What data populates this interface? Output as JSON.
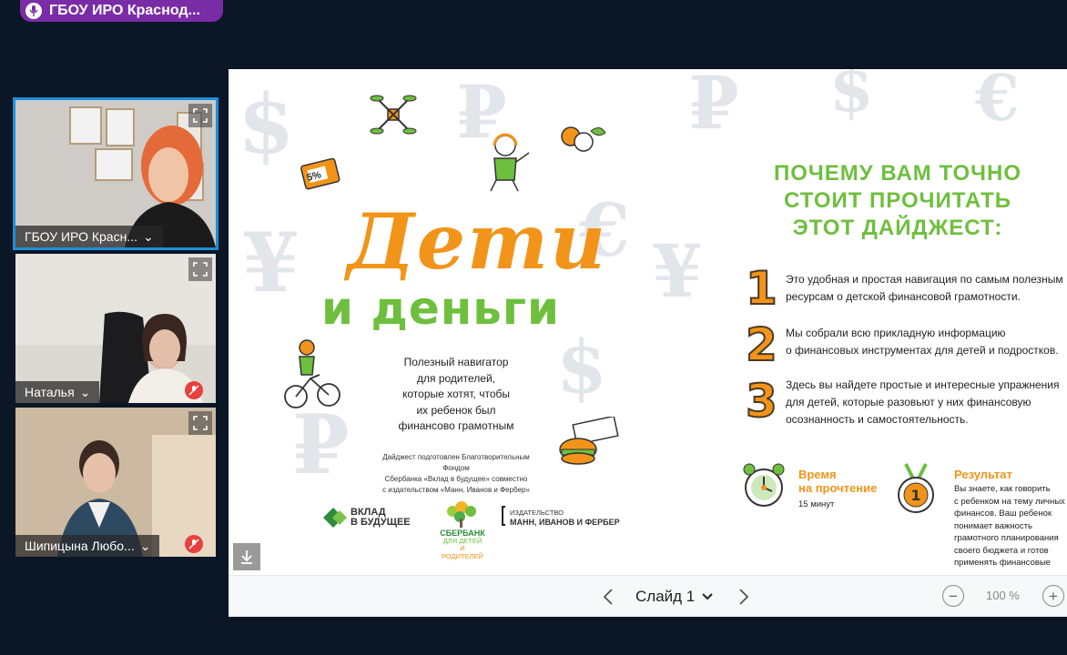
{
  "speaker": {
    "name": "ГБОУ ИРО Краснод..."
  },
  "participants": [
    {
      "name": "ГБОУ ИРО Красн...",
      "chevron": "⌄"
    },
    {
      "name": "Наталья",
      "chevron": "⌄"
    },
    {
      "name": "Шипицына Любо...",
      "chevron": "⌄"
    }
  ],
  "slide": {
    "title_line1": "Дети",
    "title_line2": "и деньги",
    "subtitle": [
      "Полезный навигатор",
      "для родителей,",
      "которые хотят, чтобы",
      "их ребенок был",
      "финансово грамотным"
    ],
    "credit": [
      "Дайджест подготовлен Благотворительным Фондом",
      "Сбербанка «Вклад в будущее» совместно",
      "с издательством «Манн, Иванов и Фербер»"
    ],
    "badge_5": "5%",
    "logos": {
      "vklad_line1": "ВКЛАД",
      "vklad_line2": "В БУДУЩЕЕ",
      "sber_line1": "СБЕРБАНК",
      "sber_line2": "ДЛЯ ДЕТЕЙ",
      "sber_line3": "И РОДИТЕЛЕЙ",
      "mif_line1": "ИЗДАТЕЛЬСТВО",
      "mif_line2": "МАНН, ИВАНОВ И ФЕРБЕР"
    },
    "heading": [
      "ПОЧЕМУ ВАМ ТОЧНО",
      "СТОИТ ПРОЧИТАТЬ",
      "ЭТОТ ДАЙДЖЕСТ:"
    ],
    "points": [
      {
        "num": "1",
        "text": [
          "Это удобная и простая навигация по самым полезным",
          "ресурсам о детской финансовой грамотности."
        ]
      },
      {
        "num": "2",
        "text": [
          "Мы собрали всю прикладную информацию",
          "о финансовых инструментах для детей и подростков."
        ]
      },
      {
        "num": "3",
        "text": [
          "Здесь вы найдете простые и интересные упражнения",
          "для детей, которые разовьют у них финансовую",
          "осознанность и самостоятельность."
        ]
      }
    ],
    "time_title": [
      "Время",
      "на прочтение"
    ],
    "time_value": "15 минут",
    "result_title": "Результат",
    "result_text": [
      "Вы знаете, как говорить",
      "с ребенком на тему личных",
      "финансов. Ваш ребенок",
      "понимает важность",
      "грамотного планирования",
      "своего бюджета и готов",
      "применять финансовые"
    ]
  },
  "toolbar": {
    "slide_label": "Слайд 1",
    "zoom": "100 %",
    "zoom_out": "−",
    "zoom_in": "+"
  },
  "colors": {
    "background": "#0b1626",
    "speaker_pill": "#7a2ca6",
    "active_border": "#1c8fd8",
    "orange": "#f29419",
    "green": "#6ebf3e",
    "muted_red": "#e8403c"
  }
}
